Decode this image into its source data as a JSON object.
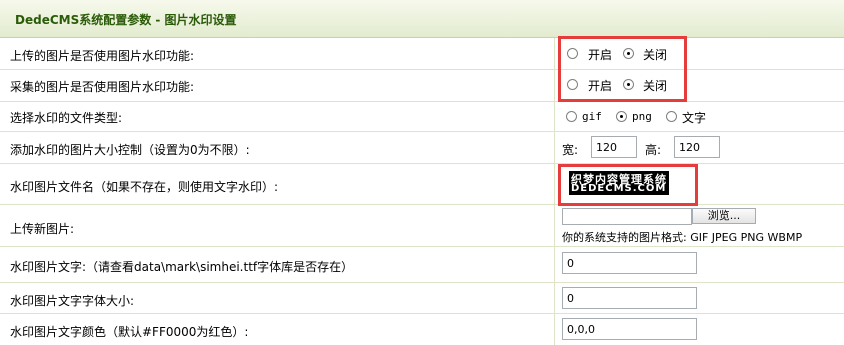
{
  "title": "DedeCMS系统配置参数 - 图片水印设置",
  "rows": [
    {
      "label": "上传的图片是否使用图片水印功能:",
      "options": [
        "开启",
        "关闭"
      ],
      "selected": "关闭"
    },
    {
      "label": "采集的图片是否使用图片水印功能:",
      "options": [
        "开启",
        "关闭"
      ],
      "selected": "关闭"
    },
    {
      "label": "选择水印的文件类型:",
      "options": [
        "gif",
        "png",
        "文字"
      ],
      "selected": "png"
    },
    {
      "label": "添加水印的图片大小控制（设置为0为不限）:",
      "width_label": "宽:",
      "width_value": "120",
      "height_label": "高:",
      "height_value": "120"
    },
    {
      "label": "水印图片文件名（如果不存在，则使用文字水印）:",
      "watermark_line1": "织梦内容管理系统",
      "watermark_line2": "DEDECMS.COM"
    },
    {
      "label": "上传新图片:",
      "browse_label": "浏览...",
      "file_value": "",
      "formats_text": "你的系统支持的图片格式: GIF JPEG PNG WBMP"
    },
    {
      "label": "水印图片文字:（请查看data\\mark\\simhei.ttf字体库是否存在）",
      "value": "0"
    },
    {
      "label": "水印图片文字字体大小:",
      "value": "0"
    },
    {
      "label": "水印图片文字颜色（默认#FF0000为红色）:",
      "value": "0,0,0"
    }
  ],
  "colors": {
    "highlight": "#e53c3c",
    "title": "#2b5b09"
  }
}
